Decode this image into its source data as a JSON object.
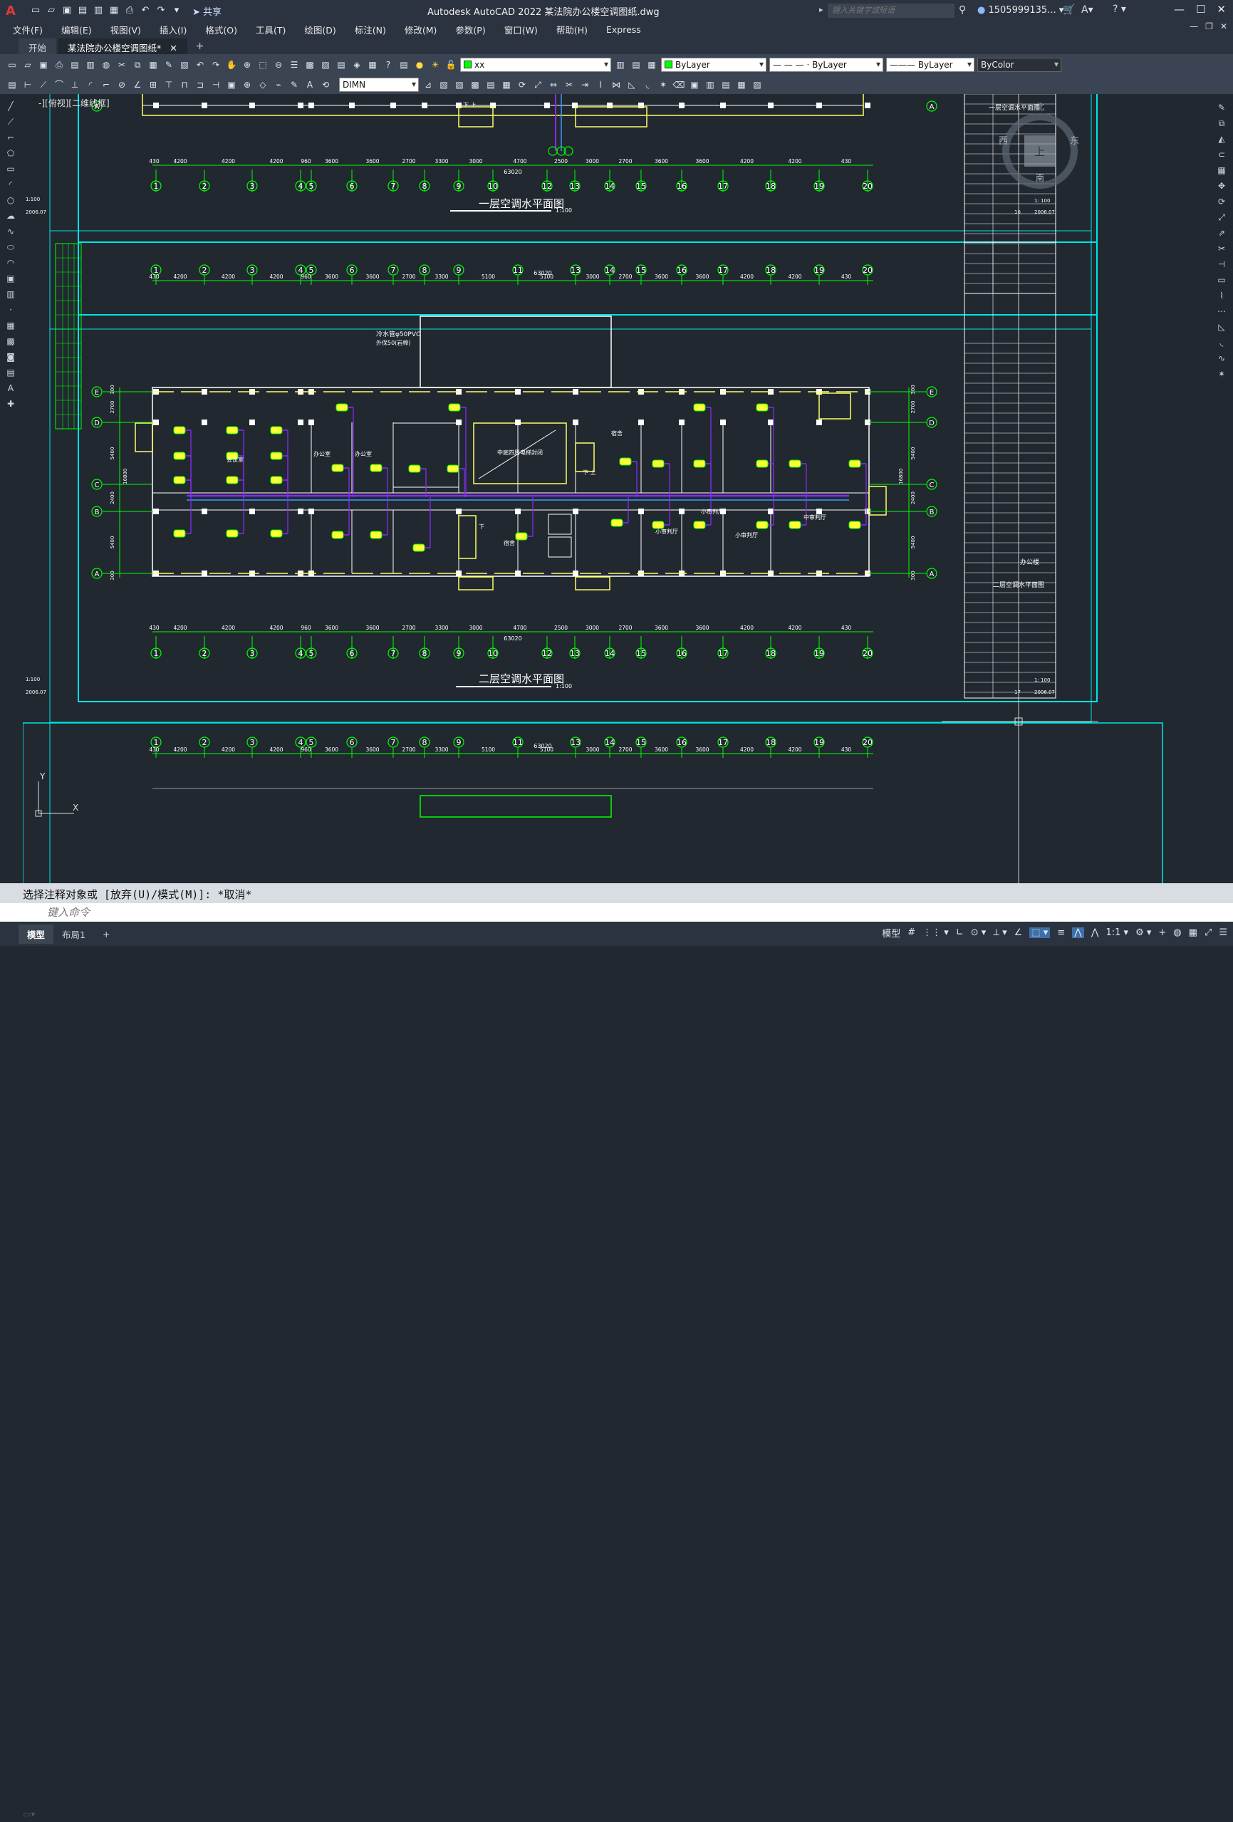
{
  "app": {
    "logo": "A",
    "share_label": "共享",
    "title": "Autodesk AutoCAD 2022    某法院办公楼空调图纸.dwg",
    "search_placeholder": "键入关键字或短语",
    "user": "1505999135...",
    "help": "?"
  },
  "menu": [
    "文件(F)",
    "编辑(E)",
    "视图(V)",
    "插入(I)",
    "格式(O)",
    "工具(T)",
    "绘图(D)",
    "标注(N)",
    "修改(M)",
    "参数(P)",
    "窗口(W)",
    "帮助(H)",
    "Express"
  ],
  "tabs": [
    {
      "label": "开始"
    },
    {
      "label": "某法院办公楼空调图纸*"
    }
  ],
  "toolbar": {
    "layer": "xx",
    "color": "ByLayer",
    "linetype": "— — — · ByLayer",
    "lineweight": "——— ByLayer",
    "plotstyle": "ByColor",
    "dimstyle": "DIMN"
  },
  "viewport_label": "-][俯视][二维线框]",
  "viewcube": {
    "n": "北",
    "s": "南",
    "e": "东",
    "w": "西",
    "face": "上"
  },
  "drawing": {
    "plan1_title": "一层空调水平面图",
    "plan2_title": "二层空调水平面图",
    "scale": "1:100",
    "overall_dim": "63020",
    "axis_numbers": [
      "1",
      "2",
      "3",
      "4",
      "5",
      "6",
      "7",
      "8",
      "9",
      "10",
      "12",
      "13",
      "14",
      "15",
      "16",
      "17",
      "18",
      "19",
      "20"
    ],
    "axis_numbers_top": [
      "1",
      "2",
      "3",
      "4",
      "5",
      "6",
      "7",
      "8",
      "9",
      "11",
      "13",
      "14",
      "15",
      "16",
      "17",
      "18",
      "19",
      "20"
    ],
    "axis_letters": [
      "E",
      "D",
      "C",
      "B",
      "A"
    ],
    "dims_bottom": [
      "430",
      "4200",
      "4200",
      "4200",
      "960",
      "3600",
      "3600",
      "2700",
      "3300",
      "3000",
      "4700",
      "2500",
      "3000",
      "2700",
      "3600",
      "3600",
      "4200",
      "4200",
      "430"
    ],
    "dims_top": [
      "430",
      "4200",
      "4200",
      "4200",
      "960",
      "3600",
      "3600",
      "2700",
      "3300",
      "5100",
      "5100",
      "3000",
      "2700",
      "3600",
      "3600",
      "4200",
      "4200",
      "430"
    ],
    "dims_side": [
      "300",
      "2700",
      "5400",
      "2400",
      "5400",
      "300"
    ],
    "side_total": "16800",
    "pipe_note1": "冷水管φ50PVC",
    "pipe_note2": "外保50(岩棉)",
    "rooms": [
      "办公室",
      "办公室",
      "会议室",
      "中庭四周电梯封闭",
      "小审判厅",
      "小审判厅",
      "小审判厅",
      "中审判厅",
      "宿舍",
      "宿舍",
      "下",
      "下 上"
    ],
    "title_block": {
      "sheet1": "一层空调水平面图",
      "sheet2": "二层空调水平面图",
      "project": "办公楼",
      "scale": "1: 100",
      "date": "2006.07",
      "num1": "16",
      "num2": "17"
    }
  },
  "command": {
    "history": "选择注释对象或 [放弃(U)/模式(M)]: *取消*",
    "placeholder": "键入命令"
  },
  "layouts": [
    {
      "label": "模型"
    },
    {
      "label": "布局1"
    }
  ],
  "status": {
    "model": "模型",
    "scale": "1:1"
  }
}
